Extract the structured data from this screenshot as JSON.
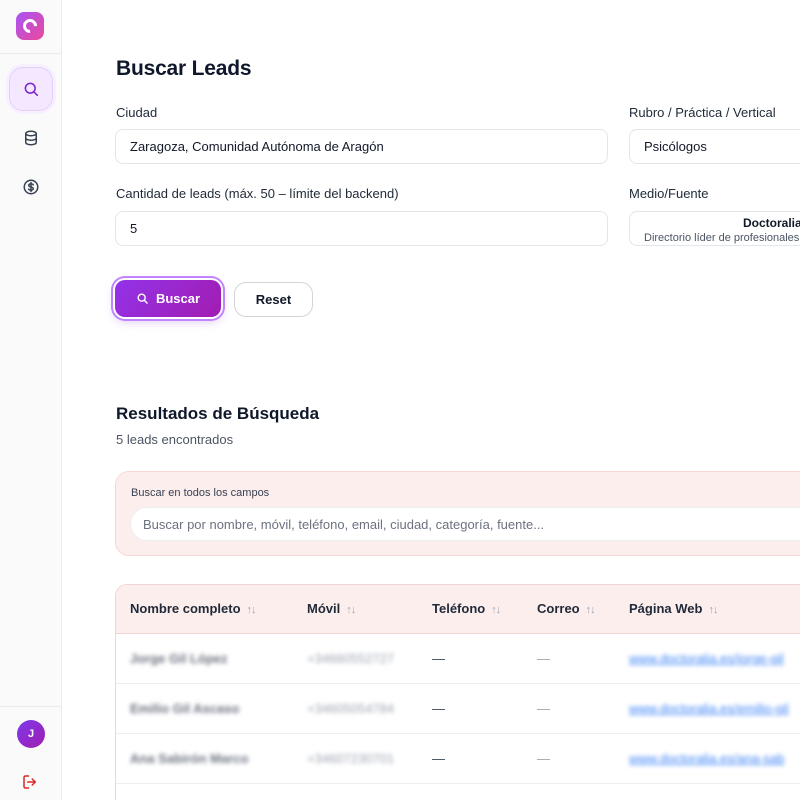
{
  "sidebar": {
    "logo_icon": "brand-c-logo",
    "nav": [
      {
        "icon": "search-icon",
        "active": true
      },
      {
        "icon": "database-icon",
        "active": false
      },
      {
        "icon": "dollar-circle-icon",
        "active": false
      }
    ],
    "avatar_initial": "J",
    "logout_icon": "logout-icon"
  },
  "search_form": {
    "title": "Buscar Leads",
    "city_label": "Ciudad",
    "city_value": "Zaragoza, Comunidad Autónoma de Aragón",
    "vertical_label": "Rubro / Práctica / Vertical",
    "vertical_value": "Psicólogos",
    "quantity_label": "Cantidad de leads (máx. 50 – límite del backend)",
    "quantity_value": "5",
    "source_label": "Medio/Fuente",
    "source_name": "Doctoralia",
    "source_description": "Directorio líder de profesionales",
    "search_button": "Buscar",
    "reset_button": "Reset"
  },
  "results": {
    "title": "Resultados de Búsqueda",
    "count_text": "5 leads encontrados",
    "filter_label": "Buscar en todos los campos",
    "filter_placeholder": "Buscar por nombre, móvil, teléfono, email, ciudad, categoría, fuente...",
    "columns": [
      "Nombre completo",
      "Móvil",
      "Teléfono",
      "Correo",
      "Página Web"
    ],
    "rows": [
      {
        "name": "Jorge Gil López",
        "mobile": "+34660552727",
        "phone": "—",
        "email": "—",
        "web": "www.doctoralia.es/jorge-gil"
      },
      {
        "name": "Emilio Gil Ascaso",
        "mobile": "+34605054784",
        "phone": "—",
        "email": "—",
        "web": "www.doctoralia.es/emilio-gil"
      },
      {
        "name": "Ana Sabirón Marco",
        "mobile": "+34607230701",
        "phone": "—",
        "email": "—",
        "web": "www.doctoralia.es/ana-sab"
      }
    ]
  },
  "colors": {
    "accent": "#9333ea",
    "accent_light": "#f3e8ff",
    "results_bg": "#fdeeee",
    "link": "#3b82f6"
  }
}
